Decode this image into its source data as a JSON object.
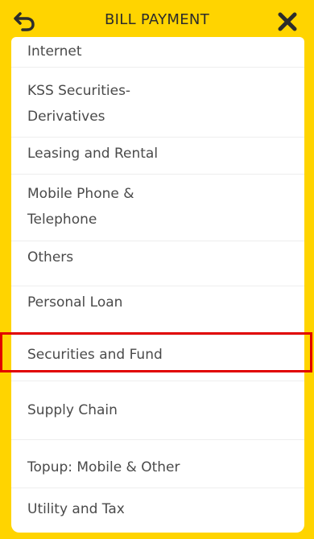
{
  "header": {
    "title": "BILL PAYMENT",
    "back_icon": "back-arrow-icon",
    "close_icon": "close-x-icon"
  },
  "colors": {
    "frame": "#ffd400",
    "text": "#4a4a4a",
    "highlight": "#e10000"
  },
  "categories": [
    {
      "label": "Internet"
    },
    {
      "label": "KSS Securities-Derivatives"
    },
    {
      "label": "Leasing and Rental"
    },
    {
      "label": "Mobile Phone & Telephone"
    },
    {
      "label": "Others"
    },
    {
      "label": "Personal Loan"
    },
    {
      "label": "Securities and Fund"
    },
    {
      "label": "Supply Chain"
    },
    {
      "label": "Topup: Mobile & Other"
    },
    {
      "label": "Utility and Tax"
    }
  ]
}
